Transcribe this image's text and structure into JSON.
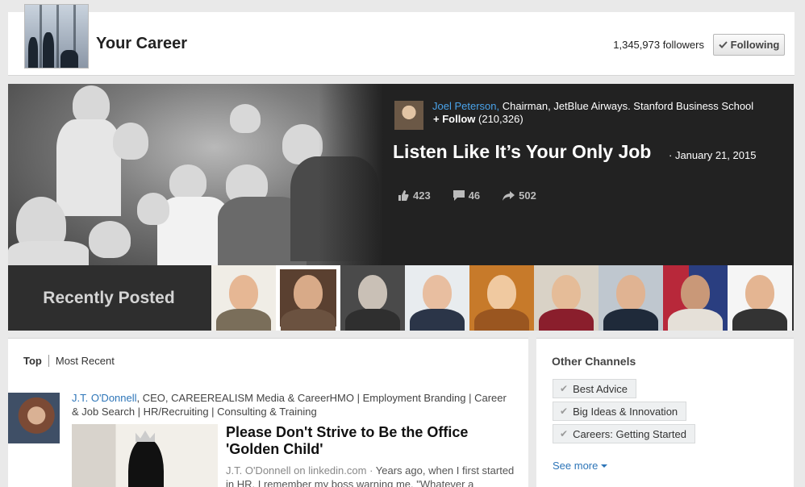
{
  "header": {
    "title": "Your Career",
    "followers": "1,345,973 followers",
    "following_label": "Following"
  },
  "hero": {
    "author_name": "Joel Peterson,",
    "author_title": "Chairman, JetBlue Airways. Stanford Business School",
    "follow_label": "Follow",
    "follow_count": "(210,326)",
    "headline": "Listen Like It’s Your Only Job",
    "date": "January 21, 2015",
    "likes": "423",
    "comments": "46",
    "shares": "502"
  },
  "recent": {
    "label": "Recently Posted"
  },
  "feed": {
    "tabs": [
      "Top",
      "Most Recent"
    ],
    "post": {
      "author_name": "J.T. O'Donnell",
      "author_title": ", CEO, CAREEREALISM Media & CareerHMO | Employment Branding | Career & Job Search | HR/Recruiting | Consulting & Training",
      "title": "Please Don't Strive to Be the Office 'Golden Child'",
      "source": "J.T. O'Donnell on linkedin.com",
      "separator": " · ",
      "snippet": "Years ago, when I first started in HR, I remember my boss warning me. \"Whatever a"
    }
  },
  "channels": {
    "title": "Other Channels",
    "items": [
      "Best Advice",
      "Big Ideas & Innovation",
      "Careers: Getting Started"
    ],
    "see_more": "See more"
  },
  "colors": {
    "link_blue": "#2d75b8",
    "hero_bg": "#222222",
    "strip_bg": "#2e2e2e"
  }
}
